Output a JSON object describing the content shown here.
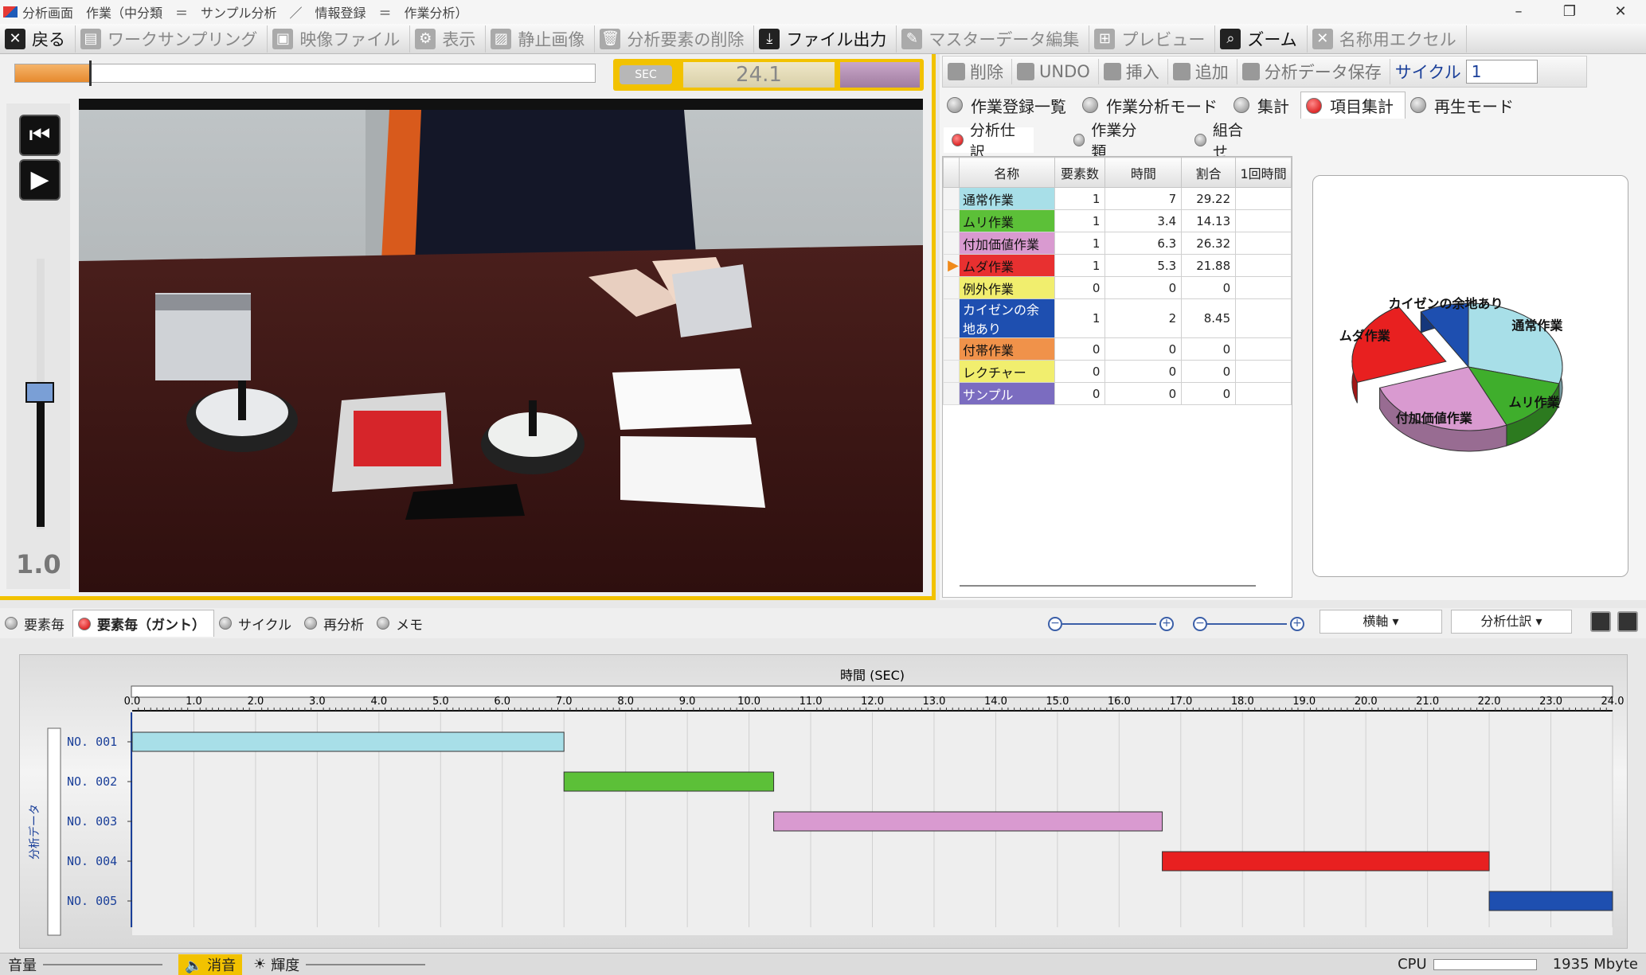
{
  "window": {
    "title": "分析画面　作業（中分類　＝　サンプル分析　／　情報登録　＝　作業分析）",
    "controls": [
      "–",
      "❐",
      "✕"
    ]
  },
  "toolbar": [
    {
      "label": "戻る",
      "icon": "✕",
      "active": true
    },
    {
      "label": "ワークサンプリング",
      "icon": "▤",
      "active": false
    },
    {
      "label": "映像ファイル",
      "icon": "▣",
      "active": false
    },
    {
      "label": "表示",
      "icon": "⚙",
      "active": false
    },
    {
      "label": "静止画像",
      "icon": "▨",
      "active": false
    },
    {
      "label": "分析要素の削除",
      "icon": "🗑",
      "active": false
    },
    {
      "label": "ファイル出力",
      "icon": "⤓",
      "active": true
    },
    {
      "label": "マスターデータ編集",
      "icon": "✎",
      "active": false
    },
    {
      "label": "プレビュー",
      "icon": "⊞",
      "active": false
    },
    {
      "label": "ズーム",
      "icon": "⌕",
      "active": true
    },
    {
      "label": "名称用エクセル",
      "icon": "✕",
      "active": false
    }
  ],
  "player": {
    "sec_label": "SEC",
    "sec_value": "24.1",
    "speed": "1.0",
    "progress": 0.2
  },
  "right_toolbar": {
    "buttons": [
      "削除",
      "UNDO",
      "挿入",
      "追加",
      "分析データ保存"
    ],
    "cycle_label": "サイクル",
    "cycle_value": "1"
  },
  "right_tabs": [
    {
      "label": "作業登録一覧",
      "selected": false
    },
    {
      "label": "作業分析モード",
      "selected": false
    },
    {
      "label": "集計",
      "selected": false
    },
    {
      "label": "項目集計",
      "selected": true
    },
    {
      "label": "再生モード",
      "selected": false
    }
  ],
  "sub_tabs": [
    {
      "label": "分析仕訳",
      "selected": true
    },
    {
      "label": "作業分類",
      "selected": false
    },
    {
      "label": "組合せ",
      "selected": false
    }
  ],
  "table": {
    "headers": [
      "名称",
      "要素数",
      "時間",
      "割合",
      "1回時間"
    ],
    "rows": [
      {
        "name": "通常作業",
        "count": "1",
        "time": "7",
        "ratio": "29.22",
        "color": "#a8dfe8",
        "current": false
      },
      {
        "name": "ムリ作業",
        "count": "1",
        "time": "3.4",
        "ratio": "14.13",
        "color": "#5cc038",
        "current": false
      },
      {
        "name": "付加価値作業",
        "count": "1",
        "time": "6.3",
        "ratio": "26.32",
        "color": "#d99ad0",
        "current": false
      },
      {
        "name": "ムダ作業",
        "count": "1",
        "time": "5.3",
        "ratio": "21.88",
        "color": "#e83030",
        "current": true
      },
      {
        "name": "例外作業",
        "count": "0",
        "time": "0",
        "ratio": "0",
        "color": "#f1ee6e",
        "current": false
      },
      {
        "name": "カイゼンの余地あり",
        "count": "1",
        "time": "2",
        "ratio": "8.45",
        "color": "#1e4fb0",
        "current": false
      },
      {
        "name": "付帯作業",
        "count": "0",
        "time": "0",
        "ratio": "0",
        "color": "#f0924a",
        "current": false
      },
      {
        "name": "レクチャー",
        "count": "0",
        "time": "0",
        "ratio": "0",
        "color": "#f1ee6e",
        "current": false
      },
      {
        "name": "サンプル",
        "count": "0",
        "time": "0",
        "ratio": "0",
        "color": "#7b6cc0",
        "current": false
      }
    ]
  },
  "pie": {
    "slices": [
      {
        "label": "通常作業",
        "value": 29.22,
        "color": "#a8dfe8"
      },
      {
        "label": "ムリ作業",
        "value": 14.13,
        "color": "#3fae2c"
      },
      {
        "label": "付加価値作業",
        "value": 26.32,
        "color": "#d99ad0"
      },
      {
        "label": "ムダ作業",
        "value": 21.88,
        "color": "#e82020"
      },
      {
        "label": "カイゼンの余地あり",
        "value": 8.45,
        "color": "#1e4fb0"
      }
    ]
  },
  "bottom_tabs": [
    {
      "label": "要素毎",
      "selected": false
    },
    {
      "label": "要素毎（ガント）",
      "selected": true
    },
    {
      "label": "サイクル",
      "selected": false
    },
    {
      "label": "再分析",
      "selected": false
    },
    {
      "label": "メモ",
      "selected": false
    }
  ],
  "dropdowns": {
    "axis": "横軸",
    "mode": "分析仕訳"
  },
  "chart_data": {
    "type": "gantt",
    "title": "時間 (SEC)",
    "ylabel": "分析データ",
    "xlim": [
      0,
      24
    ],
    "xticks": [
      "0.0",
      "1.0",
      "2.0",
      "3.0",
      "4.0",
      "5.0",
      "6.0",
      "7.0",
      "8.0",
      "9.0",
      "10.0",
      "11.0",
      "12.0",
      "13.0",
      "14.0",
      "15.0",
      "16.0",
      "17.0",
      "18.0",
      "19.0",
      "20.0",
      "21.0",
      "22.0",
      "23.0",
      "24.0"
    ],
    "rows": [
      {
        "label": "NO. 001",
        "start": 0,
        "end": 7.0,
        "color": "#a8dfe8"
      },
      {
        "label": "NO. 002",
        "start": 7.0,
        "end": 10.4,
        "color": "#5cc038"
      },
      {
        "label": "NO. 003",
        "start": 10.4,
        "end": 16.7,
        "color": "#d99ad0"
      },
      {
        "label": "NO. 004",
        "start": 16.7,
        "end": 22.0,
        "color": "#e82020"
      },
      {
        "label": "NO. 005",
        "start": 22.0,
        "end": 24.0,
        "color": "#1e4fb0"
      }
    ]
  },
  "status": {
    "volume_label": "音量",
    "mute_label": "消音",
    "brightness_label": "輝度",
    "cpu_label": "CPU",
    "memory": "1935 Mbyte"
  }
}
